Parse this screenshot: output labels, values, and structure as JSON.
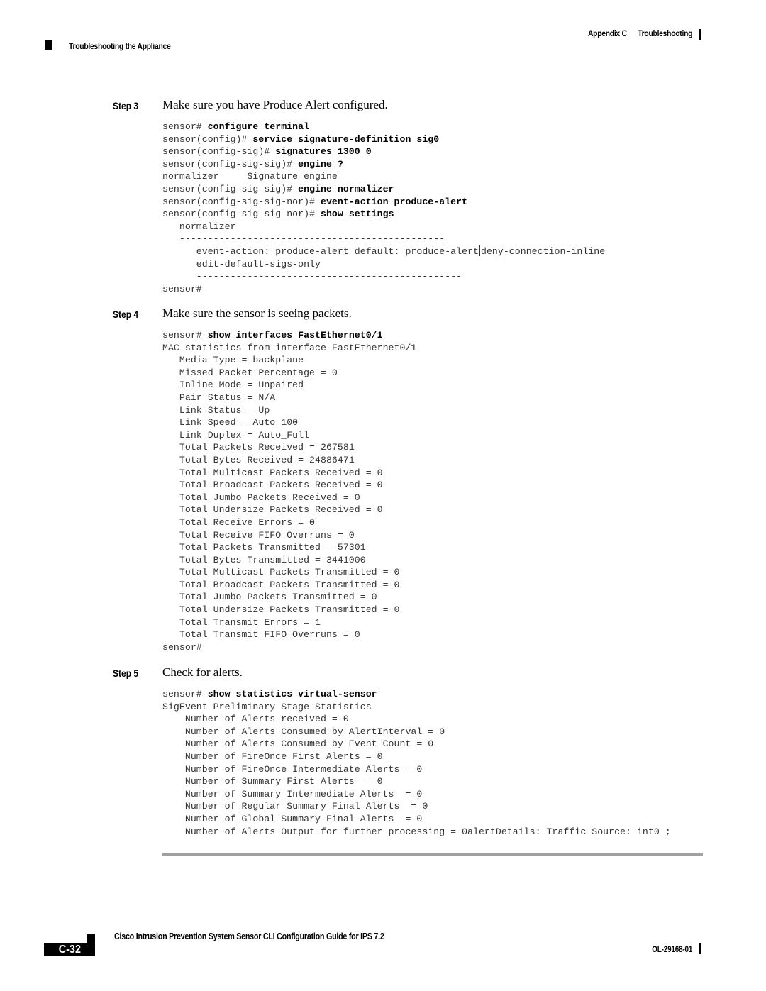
{
  "header": {
    "appendix": "Appendix C",
    "chapter": "Troubleshooting",
    "section": "Troubleshooting the Appliance"
  },
  "steps": [
    {
      "label": "Step 3",
      "title": "Make sure you have Produce Alert configured.",
      "lines": [
        {
          "prompt": "sensor# ",
          "cmd": "configure terminal"
        },
        {
          "prompt": "sensor(config)# ",
          "cmd": "service signature-definition sig0"
        },
        {
          "prompt": "sensor(config-sig)# ",
          "cmd": "signatures 1300 0"
        },
        {
          "prompt": "sensor(config-sig-sig)# ",
          "cmd": "engine ?"
        },
        {
          "text": "normalizer     Signature engine"
        },
        {
          "prompt": "sensor(config-sig-sig)# ",
          "cmd": "engine normalizer"
        },
        {
          "prompt": "sensor(config-sig-sig-nor)# ",
          "cmd": "event-action produce-alert"
        },
        {
          "prompt": "sensor(config-sig-sig-nor)# ",
          "cmd": "show settings"
        },
        {
          "text": "   normalizer"
        },
        {
          "text": "   -----------------------------------------------"
        },
        {
          "text": "      event-action: produce-alert default: produce-alert",
          "pipe_after": "deny-connection-inline"
        },
        {
          "text": "      edit-default-sigs-only"
        },
        {
          "text": "      -----------------------------------------------"
        },
        {
          "text": "sensor#"
        }
      ]
    },
    {
      "label": "Step 4",
      "title": "Make sure the sensor is seeing packets.",
      "lines": [
        {
          "prompt": "sensor# ",
          "cmd": "show interfaces FastEthernet0/1"
        },
        {
          "text": "MAC statistics from interface FastEthernet0/1"
        },
        {
          "text": "   Media Type = backplane"
        },
        {
          "text": "   Missed Packet Percentage = 0"
        },
        {
          "text": "   Inline Mode = Unpaired"
        },
        {
          "text": "   Pair Status = N/A"
        },
        {
          "text": "   Link Status = Up"
        },
        {
          "text": "   Link Speed = Auto_100"
        },
        {
          "text": "   Link Duplex = Auto_Full"
        },
        {
          "text": "   Total Packets Received = 267581"
        },
        {
          "text": "   Total Bytes Received = 24886471"
        },
        {
          "text": "   Total Multicast Packets Received = 0"
        },
        {
          "text": "   Total Broadcast Packets Received = 0"
        },
        {
          "text": "   Total Jumbo Packets Received = 0"
        },
        {
          "text": "   Total Undersize Packets Received = 0"
        },
        {
          "text": "   Total Receive Errors = 0"
        },
        {
          "text": "   Total Receive FIFO Overruns = 0"
        },
        {
          "text": "   Total Packets Transmitted = 57301"
        },
        {
          "text": "   Total Bytes Transmitted = 3441000"
        },
        {
          "text": "   Total Multicast Packets Transmitted = 0"
        },
        {
          "text": "   Total Broadcast Packets Transmitted = 0"
        },
        {
          "text": "   Total Jumbo Packets Transmitted = 0"
        },
        {
          "text": "   Total Undersize Packets Transmitted = 0"
        },
        {
          "text": "   Total Transmit Errors = 1"
        },
        {
          "text": "   Total Transmit FIFO Overruns = 0"
        },
        {
          "text": "sensor#"
        }
      ]
    },
    {
      "label": "Step 5",
      "title": "Check for alerts.",
      "lines": [
        {
          "prompt": "sensor# ",
          "cmd": "show statistics virtual-sensor"
        },
        {
          "text": "SigEvent Preliminary Stage Statistics"
        },
        {
          "text": "    Number of Alerts received = 0"
        },
        {
          "text": "    Number of Alerts Consumed by AlertInterval = 0"
        },
        {
          "text": "    Number of Alerts Consumed by Event Count = 0"
        },
        {
          "text": "    Number of FireOnce First Alerts = 0"
        },
        {
          "text": "    Number of FireOnce Intermediate Alerts = 0"
        },
        {
          "text": "    Number of Summary First Alerts  = 0"
        },
        {
          "text": "    Number of Summary Intermediate Alerts  = 0"
        },
        {
          "text": "    Number of Regular Summary Final Alerts  = 0"
        },
        {
          "text": "    Number of Global Summary Final Alerts  = 0"
        },
        {
          "text": "    Number of Alerts Output for further processing = 0alertDetails: Traffic Source: int0 ;"
        }
      ]
    }
  ],
  "footer": {
    "guide_title": "Cisco Intrusion Prevention System Sensor CLI Configuration Guide for IPS 7.2",
    "page_number": "C-32",
    "doc_number": "OL-29168-01"
  }
}
